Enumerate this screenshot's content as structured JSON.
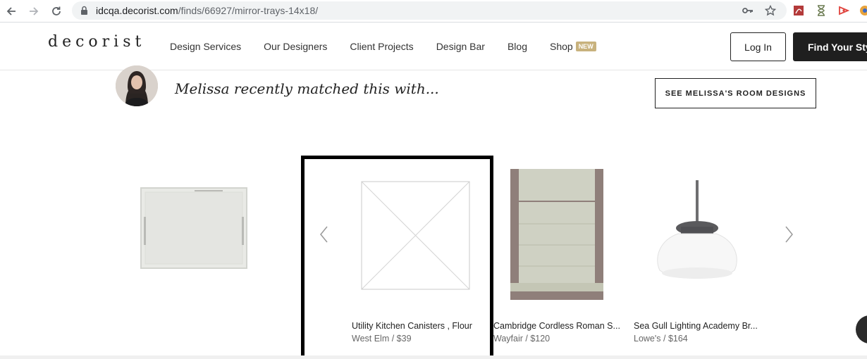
{
  "browser": {
    "url_domain": "idcqa.decorist.com",
    "url_path": "/finds/66927/mirror-trays-14x18/",
    "icons": [
      "back-arrow-icon",
      "forward-arrow-icon",
      "reload-icon",
      "lock-icon",
      "key-icon",
      "star-icon",
      "pdf-extension-icon",
      "hourglass-extension-icon",
      "media-extension-icon",
      "profile-icon"
    ]
  },
  "header": {
    "logo": "decorist",
    "nav": [
      "Design Services",
      "Our Designers",
      "Client Projects",
      "Design Bar",
      "Blog",
      "Shop"
    ],
    "shop_badge": "NEW",
    "login_label": "Log In",
    "cta_label": "Find Your Style"
  },
  "designer": {
    "matched_text": "Melissa recently matched this with...",
    "room_button": "SEE MELISSA'S ROOM DESIGNS"
  },
  "products": [
    {
      "name": "",
      "meta": "",
      "image": "mirror-tray"
    },
    {
      "name": "Utility Kitchen Canisters , Flour",
      "meta": "West Elm / $39",
      "image": "placeholder"
    },
    {
      "name": "Cambridge Cordless Roman S...",
      "meta": "Wayfair / $120",
      "image": "roman-shade"
    },
    {
      "name": "Sea Gull Lighting Academy Br...",
      "meta": "Lowe's / $164",
      "image": "pendant-light"
    }
  ],
  "colors": {
    "accent_badge": "#c8b27d",
    "dark_button": "#1f1f1f"
  }
}
